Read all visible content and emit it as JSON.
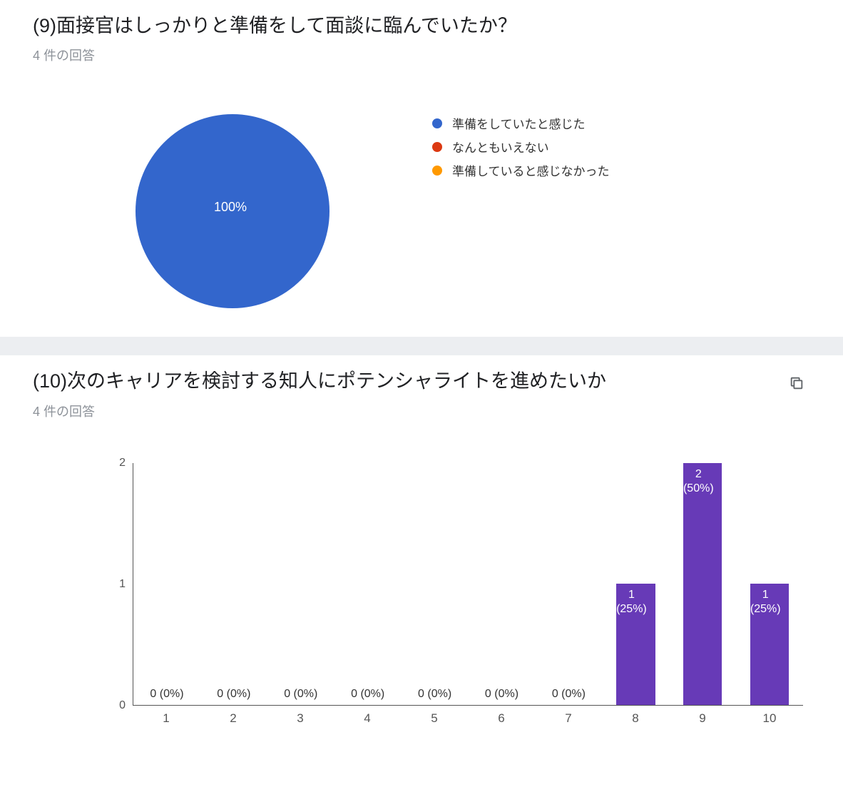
{
  "q9": {
    "title": "(9)面接官はしっかりと準備をして面談に臨んでいたか？",
    "responses": "4 件の回答",
    "pie_label": "100%",
    "legend": [
      {
        "label": "準備をしていたと感じた",
        "color": "#3366cc"
      },
      {
        "label": "なんともいえない",
        "color": "#dc3912"
      },
      {
        "label": "準備していると感じなかった",
        "color": "#ff9900"
      }
    ]
  },
  "q10": {
    "title": "(10)次のキャリアを検討する知人にポテンシャライトを進めたいか",
    "responses": "4 件の回答",
    "y_ticks": [
      "0",
      "1",
      "2"
    ],
    "bars": [
      {
        "x": "1",
        "label": "0 (0%)",
        "pct": 0
      },
      {
        "x": "2",
        "label": "0 (0%)",
        "pct": 0
      },
      {
        "x": "3",
        "label": "0 (0%)",
        "pct": 0
      },
      {
        "x": "4",
        "label": "0 (0%)",
        "pct": 0
      },
      {
        "x": "5",
        "label": "0 (0%)",
        "pct": 0
      },
      {
        "x": "6",
        "label": "0 (0%)",
        "pct": 0
      },
      {
        "x": "7",
        "label": "0 (0%)",
        "pct": 0
      },
      {
        "x": "8",
        "label": "1\n(25%)",
        "pct": 50
      },
      {
        "x": "9",
        "label": "2\n(50%)",
        "pct": 100
      },
      {
        "x": "10",
        "label": "1\n(25%)",
        "pct": 50
      }
    ]
  },
  "chart_data": [
    {
      "type": "pie",
      "title": "(9)面接官はしっかりと準備をして面談に臨んでいたか？",
      "n": 4,
      "categories": [
        "準備をしていたと感じた",
        "なんともいえない",
        "準備していると感じなかった"
      ],
      "values": [
        4,
        0,
        0
      ],
      "percentages": [
        100,
        0,
        0
      ]
    },
    {
      "type": "bar",
      "title": "(10)次のキャリアを検討する知人にポテンシャライトを進めたいか",
      "n": 4,
      "categories": [
        "1",
        "2",
        "3",
        "4",
        "5",
        "6",
        "7",
        "8",
        "9",
        "10"
      ],
      "values": [
        0,
        0,
        0,
        0,
        0,
        0,
        0,
        1,
        2,
        1
      ],
      "percentages": [
        0,
        0,
        0,
        0,
        0,
        0,
        0,
        25,
        50,
        25
      ],
      "ylim": [
        0,
        2
      ],
      "xlabel": "",
      "ylabel": ""
    }
  ]
}
